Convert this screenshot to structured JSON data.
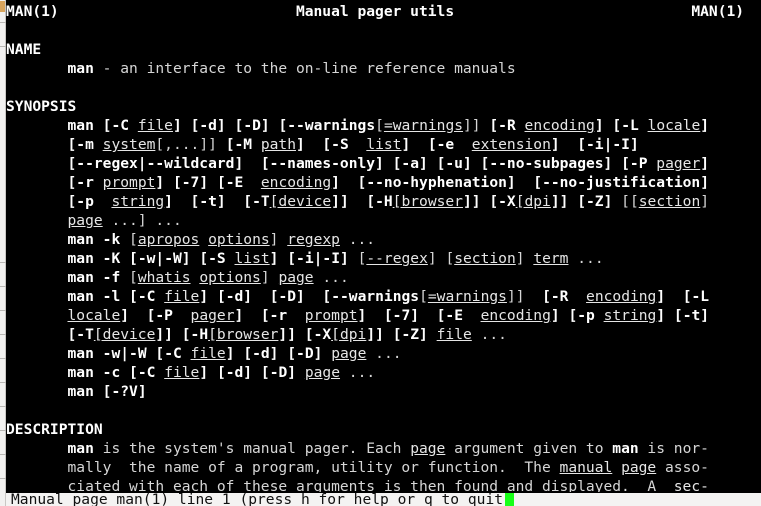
{
  "window": {
    "kind": "terminal-pager",
    "background_color": "#000000",
    "foreground_color": "#d6d6d6",
    "cursor_color": "#17ff17",
    "statusbar_background": "#f4f3f2",
    "statusbar_foreground": "#101010"
  },
  "manpage": {
    "header": {
      "left": "MAN(1)",
      "center": "Manual pager utils",
      "right": "MAN(1)"
    },
    "sections": [
      {
        "heading": "NAME"
      },
      {
        "heading": "SYNOPSIS"
      },
      {
        "heading": "DESCRIPTION"
      }
    ],
    "name_body": "man - an interface to the on-line reference manuals",
    "description_body": [
      "man is the system's manual pager.  Each page argument given to man is nor-",
      "mally  the name of a program, utility or function.  The manual page asso-",
      "ciated with each of these arguments is then found and displayed.  A  sec-"
    ],
    "synopsis_lines": [
      "man [-C file] [-d] [-D] [--warnings[=warnings]] [-R encoding] [-L locale]",
      "[-m system[,...]] [-M path]  [-S  list]  [-e  extension]  [-i|-I]",
      "[--regex|--wildcard]  [--names-only] [-a] [-u] [--no-subpages] [-P pager]",
      "[-r prompt] [-7] [-E  encoding]  [--no-hyphenation]  [--no-justification]",
      "[-p  string]  [-t]  [-T[device]]  [-H[browser]] [-X[dpi]] [-Z] [[section]",
      "page ...] ...",
      "man -k [apropos options] regexp ...",
      "man -K [-w|-W] [-S list] [-i|-I] [--regex] [section] term ...",
      "man -f [whatis options] page ...",
      "man -l [-C file] [-d]  [-D]  [--warnings[=warnings]]  [-R  encoding]  [-L",
      "locale]  [-P  pager]  [-r  prompt]  [-7]  [-E  encoding] [-p string] [-t]",
      "[-T[device]] [-H[browser]] [-X[dpi]] [-Z] file ...",
      "man -w|-W [-C file] [-d] [-D] page ...",
      "man -c [-C file] [-d] [-D] page ...",
      "man [-?V]"
    ]
  },
  "statusbar": {
    "text": "Manual page man(1) line 1 (press h for help or q to quit)",
    "page_name": "man(1)",
    "line_number": "1",
    "hint": "press h for help or q to quit",
    "cursor_visible": true
  }
}
